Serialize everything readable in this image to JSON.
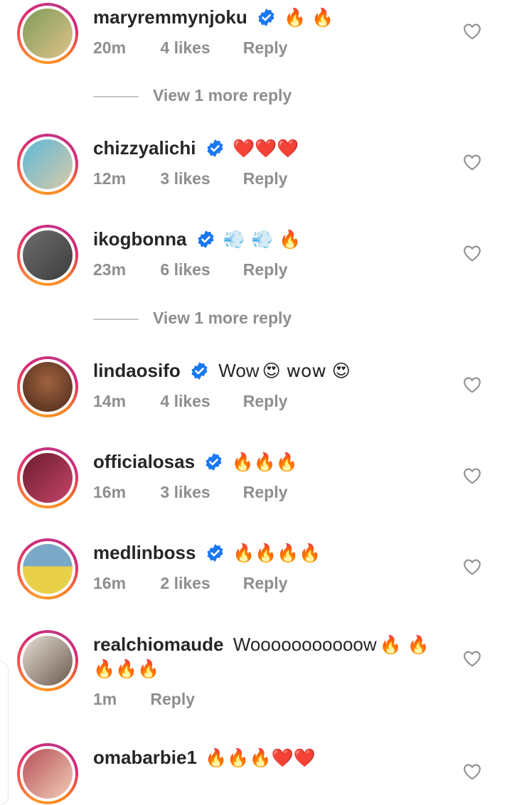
{
  "comments": [
    {
      "username": "maryremmynjoku",
      "text": "",
      "emoji": "🔥 🔥",
      "time": "20m",
      "likes": "4 likes",
      "reply": "Reply",
      "avatar_colors": [
        "#7d9c5a",
        "#e0c28a"
      ]
    },
    {
      "username": "chizzyalichi",
      "text": "",
      "emoji": "❤️❤️❤️",
      "time": "12m",
      "likes": "3 likes",
      "reply": "Reply",
      "avatar_colors": [
        "#5cb9d6",
        "#d9c9a9"
      ]
    },
    {
      "username": "ikogbonna",
      "text": "",
      "emoji": "💨 💨 🔥",
      "time": "23m",
      "likes": "6 likes",
      "reply": "Reply",
      "avatar_colors": [
        "#6d6d6d",
        "#3d3d3d"
      ]
    },
    {
      "username": "lindaosifo",
      "text": "Wow",
      "emoji": "😍 wow 😍",
      "time": "14m",
      "likes": "4 likes",
      "reply": "Reply",
      "avatar_colors": [
        "#4a2a1d",
        "#a0623d"
      ]
    },
    {
      "username": "officialosas",
      "text": "",
      "emoji": "🔥🔥🔥",
      "time": "16m",
      "likes": "3 likes",
      "reply": "Reply",
      "avatar_colors": [
        "#6b1c2c",
        "#c6446a"
      ]
    },
    {
      "username": "medlinboss",
      "text": "",
      "emoji": "🔥🔥🔥🔥",
      "time": "16m",
      "likes": "2 likes",
      "reply": "Reply",
      "avatar_colors": [
        "#e9d049",
        "#7aa9c7"
      ]
    },
    {
      "username": "realchiomaude",
      "text": "Wooooooooooow",
      "emoji": "🔥 🔥",
      "emoji_line2": "🔥🔥🔥",
      "time": "1m",
      "likes": "",
      "reply": "Reply",
      "avatar_colors": [
        "#e6ddd4",
        "#6b5a4d"
      ]
    },
    {
      "username": "omabarbie1",
      "text": "",
      "emoji": "🔥🔥🔥❤️❤️",
      "time": "",
      "likes": "",
      "reply": "",
      "avatar_colors": [
        "#b94f58",
        "#f0cdb6"
      ]
    }
  ],
  "view_more": [
    {
      "label": "View 1 more reply"
    },
    {
      "label": "View 1 more reply"
    }
  ],
  "colors": {
    "text": "#262626",
    "secondary": "#8e8e8e",
    "verified": "#1877f2",
    "divider": "#c7c7c7"
  },
  "icons": {
    "verified": "verified-badge-icon",
    "like": "heart-outline-icon"
  }
}
